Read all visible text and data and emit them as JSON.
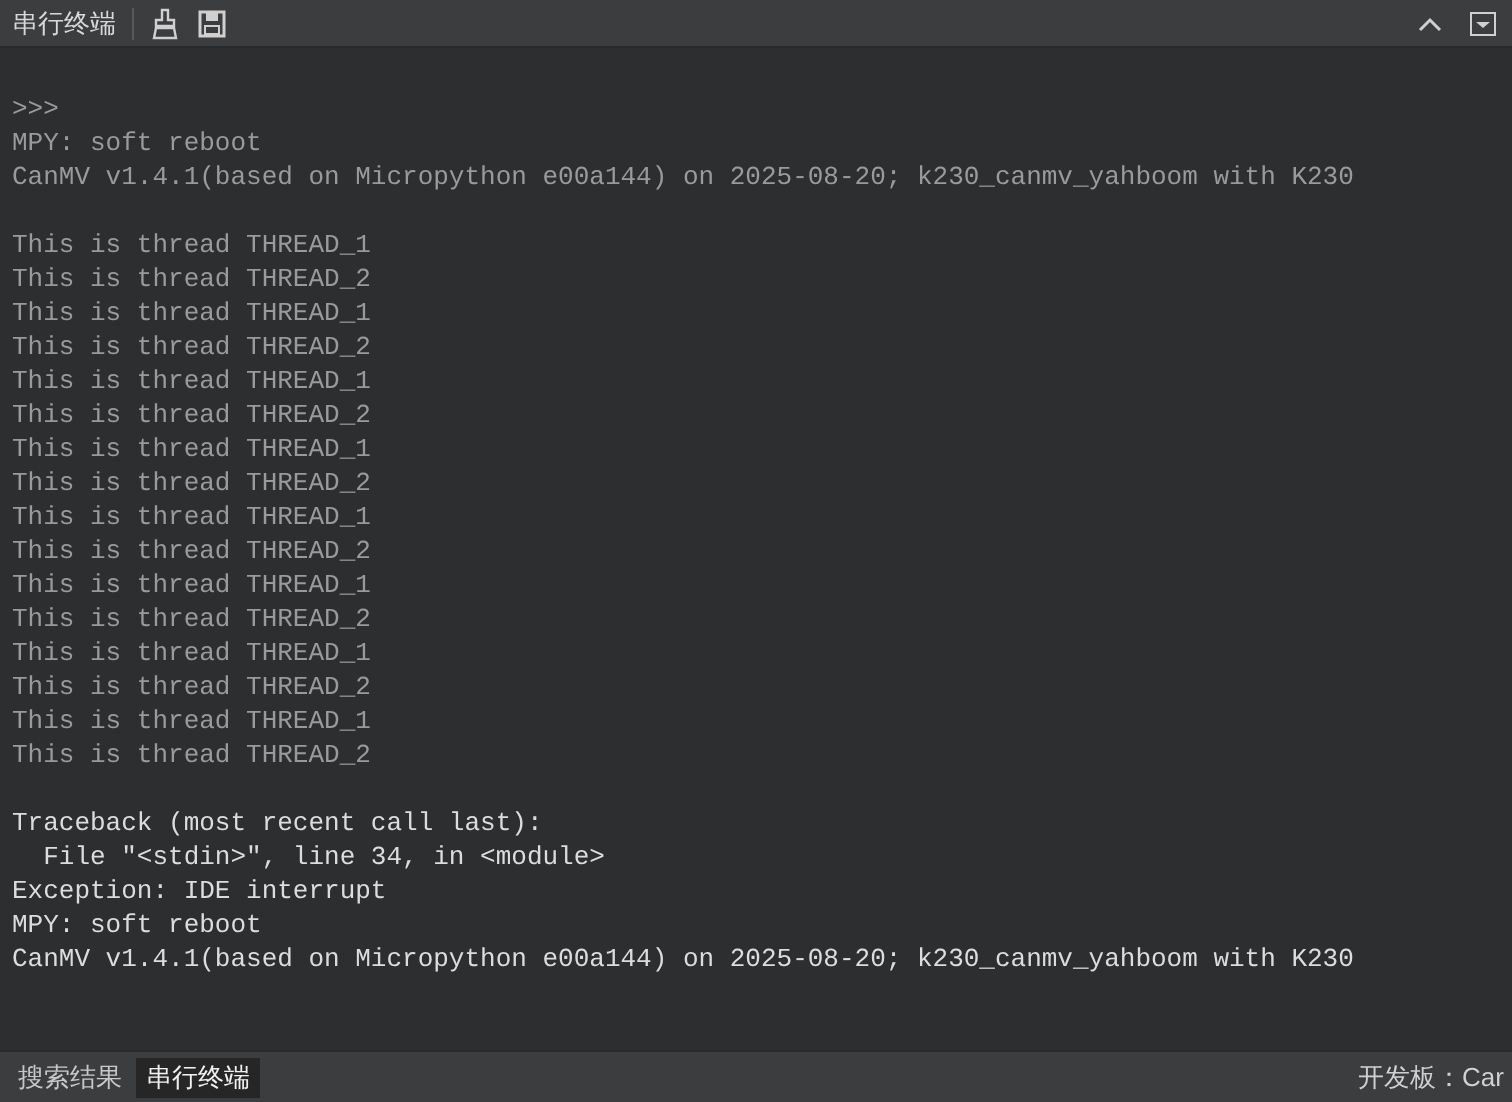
{
  "header": {
    "title": "串行终端"
  },
  "terminal": {
    "blocks": [
      {
        "kind": "output",
        "lines": [
          ">>>",
          "MPY: soft reboot",
          "CanMV v1.4.1(based on Micropython e00a144) on 2025-08-20; k230_canmv_yahboom with K230"
        ]
      },
      {
        "kind": "output",
        "lines": [
          "This is thread THREAD_1",
          "This is thread THREAD_2",
          "This is thread THREAD_1",
          "This is thread THREAD_2",
          "This is thread THREAD_1",
          "This is thread THREAD_2",
          "This is thread THREAD_1",
          "This is thread THREAD_2",
          "This is thread THREAD_1",
          "This is thread THREAD_2",
          "This is thread THREAD_1",
          "This is thread THREAD_2",
          "This is thread THREAD_1",
          "This is thread THREAD_2",
          "This is thread THREAD_1",
          "This is thread THREAD_2"
        ]
      },
      {
        "kind": "error",
        "lines": [
          "Traceback (most recent call last):",
          "  File \"<stdin>\", line 34, in <module>",
          "Exception: IDE interrupt",
          "MPY: soft reboot",
          "CanMV v1.4.1(based on Micropython e00a144) on 2025-08-20; k230_canmv_yahboom with K230"
        ]
      }
    ]
  },
  "bottom_tabs": [
    {
      "label": "搜索结果",
      "selected": false
    },
    {
      "label": "串行终端",
      "selected": true
    }
  ],
  "status": {
    "board": "开发板：Car"
  }
}
